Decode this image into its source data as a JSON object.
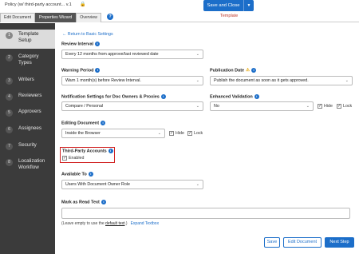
{
  "header": {
    "doc_title": "Policy (w/ third-party account... v.1",
    "tabs": [
      "Edit Document",
      "Properties Wizard",
      "Overview"
    ],
    "save_close": "Save and Close",
    "template_label": "Template"
  },
  "sidebar": {
    "steps": [
      {
        "num": "1",
        "label": "Template Setup"
      },
      {
        "num": "2",
        "label": "Category Types"
      },
      {
        "num": "3",
        "label": "Writers"
      },
      {
        "num": "4",
        "label": "Reviewers"
      },
      {
        "num": "5",
        "label": "Approvers"
      },
      {
        "num": "6",
        "label": "Assignees"
      },
      {
        "num": "7",
        "label": "Security"
      },
      {
        "num": "8",
        "label": "Localization Workflow"
      }
    ]
  },
  "form": {
    "back_link": "Return to Basic Settings",
    "review_interval": {
      "label": "Review Interval",
      "value": "Every 12 months from approve/last reviewed date"
    },
    "warning_period": {
      "label": "Warning Period",
      "value": "Warn 1 month(s) before Review Interval."
    },
    "publication_date": {
      "label": "Publication Date",
      "value": "Publish the document as soon as it gets approved."
    },
    "notification": {
      "label": "Notification Settings for Doc Owners & Proxies",
      "value": "Compare / Personal"
    },
    "enhanced_validation": {
      "label": "Enhanced Validation",
      "value": "No",
      "hide": "Hide",
      "lock": "Lock"
    },
    "editing_document": {
      "label": "Editing Document",
      "value": "Inside the Browser",
      "hide": "Hide",
      "lock": "Lock"
    },
    "third_party": {
      "label": "Third-Party Accounts",
      "enabled": "Enabled"
    },
    "available_to": {
      "label": "Available To",
      "value": "Users With Document Owner Role"
    },
    "mark_as_read": {
      "label": "Mark as Read Text",
      "hint_pre": "(Leave empty to use the ",
      "hint_link": "default text",
      "hint_post": ".)",
      "expand": "Expand Textbox"
    }
  },
  "buttons": {
    "save": "Save",
    "edit_document": "Edit Document",
    "next_step": "Next Step"
  },
  "colors": {
    "accent": "#1c6ec9",
    "sidebar_bg": "#3b3b3b",
    "highlight": "#d02020"
  }
}
